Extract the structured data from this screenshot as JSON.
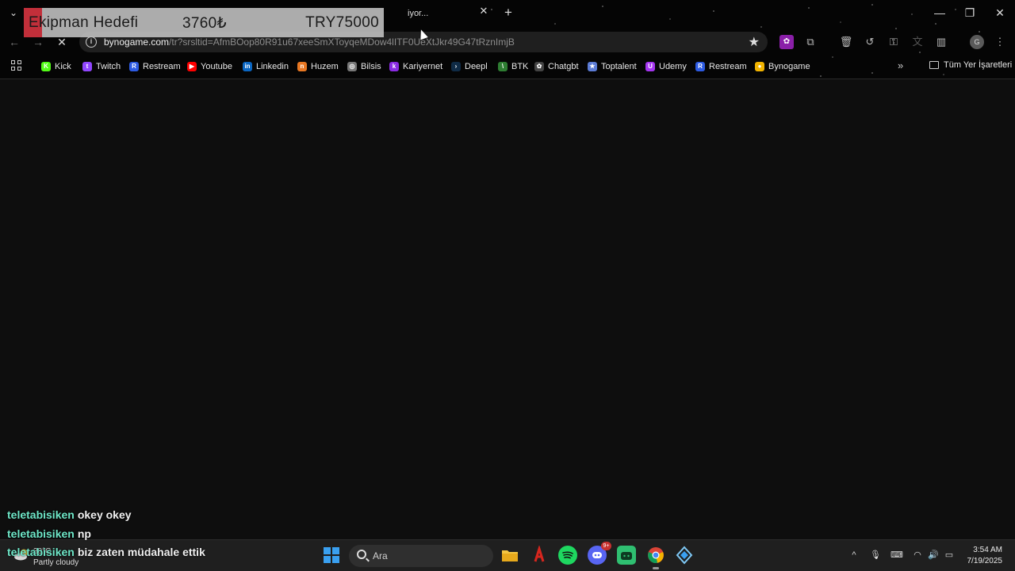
{
  "browser": {
    "tab": {
      "title": "iyor..."
    },
    "address": {
      "host": "bynogame.com",
      "path": "/tr?srsltid=AfmBOop80R91u67xeeSmXToyqeMDow4lITF0UeXtJkr49G47tRznImjB"
    },
    "bookmarks": [
      {
        "label": "Kick",
        "icon": "kick-icon",
        "color": "#53fc18"
      },
      {
        "label": "Twitch",
        "icon": "twitch-icon",
        "color": "#9146ff"
      },
      {
        "label": "Restream",
        "icon": "restream-icon",
        "color": "#2d5be3"
      },
      {
        "label": "Youtube",
        "icon": "youtube-icon",
        "color": "#ff0000"
      },
      {
        "label": "Linkedin",
        "icon": "linkedin-icon",
        "color": "#0a66c2"
      },
      {
        "label": "Huzem",
        "icon": "huzem-icon",
        "color": "#e87722"
      },
      {
        "label": "Bilsis",
        "icon": "globe-icon",
        "color": "#777777"
      },
      {
        "label": "Kariyernet",
        "icon": "kariyernet-icon",
        "color": "#8a2be2"
      },
      {
        "label": "Deepl",
        "icon": "deepl-icon",
        "color": "#0f2b46"
      },
      {
        "label": "BTK",
        "icon": "btk-icon",
        "color": "#2e7d32"
      },
      {
        "label": "Chatgbt",
        "icon": "chatgpt-icon",
        "color": "#444444"
      },
      {
        "label": "Toptalent",
        "icon": "toptalent-icon",
        "color": "#5b7bd5"
      },
      {
        "label": "Udemy",
        "icon": "udemy-icon",
        "color": "#a435f0"
      },
      {
        "label": "Restream",
        "icon": "restream-icon",
        "color": "#2d5be3"
      },
      {
        "label": "Bynogame",
        "icon": "bynogame-icon",
        "color": "#f2b400"
      }
    ],
    "all_bookmarks_label": "Tüm Yer İşaretleri"
  },
  "goal": {
    "label": "Ekipman Hedefi",
    "current": "3760₺",
    "target": "TRY75000",
    "progress_fraction": 0.05,
    "fill_color": "#c4212e"
  },
  "chat": [
    {
      "user": "teletabisiken",
      "message": "okey okey"
    },
    {
      "user": "teletabisiken",
      "message": "np"
    },
    {
      "user": "teletabisiken",
      "message": "biz zaten müdahale ettik"
    }
  ],
  "taskbar": {
    "weather_temp": "30°C",
    "weather_desc": "Partly cloudy",
    "search_placeholder": "Ara",
    "discord_badge": "9+",
    "time": "3:54 AM",
    "date": "7/19/2025"
  }
}
